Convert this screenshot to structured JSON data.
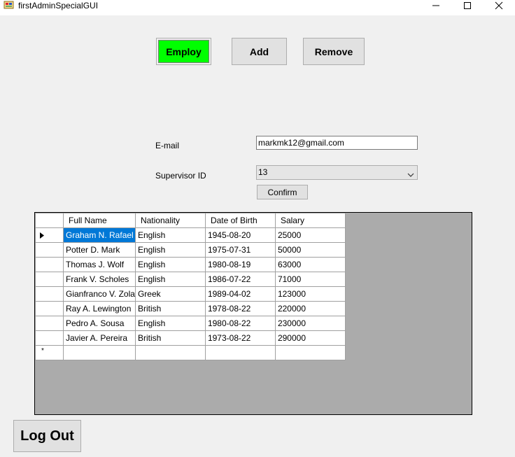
{
  "window": {
    "title": "firstAdminSpecialGUI"
  },
  "actions": {
    "employ": "Employ",
    "add": "Add",
    "remove": "Remove"
  },
  "form": {
    "email_label": "E-mail",
    "email_value": "markmk12@gmail.com",
    "supervisor_label": "Supervisor ID",
    "supervisor_value": "13",
    "confirm_label": "Confirm"
  },
  "grid": {
    "columns": [
      "Full Name",
      "Nationality",
      "Date of Birth",
      "Salary"
    ],
    "rows": [
      [
        "Graham N. Rafael",
        "English",
        "1945-08-20",
        "25000"
      ],
      [
        "Potter D. Mark",
        "English",
        "1975-07-31",
        "50000"
      ],
      [
        "Thomas J. Wolf",
        "English",
        "1980-08-19",
        "63000"
      ],
      [
        "Frank V. Scholes",
        "English",
        "1986-07-22",
        "71000"
      ],
      [
        "Gianfranco V. Zola",
        "Greek",
        "1989-04-02",
        "123000"
      ],
      [
        "Ray A. Lewington",
        "British",
        "1978-08-22",
        "220000"
      ],
      [
        "Pedro A. Sousa",
        "English",
        "1980-08-22",
        "230000"
      ],
      [
        "Javier A. Pereira",
        "British",
        "1973-08-22",
        "290000"
      ]
    ],
    "new_row_marker": "*"
  },
  "logout_label": "Log Out",
  "colors": {
    "employ_active": "#00ff00",
    "selection": "#0078d7",
    "grid_background": "#ababab"
  }
}
